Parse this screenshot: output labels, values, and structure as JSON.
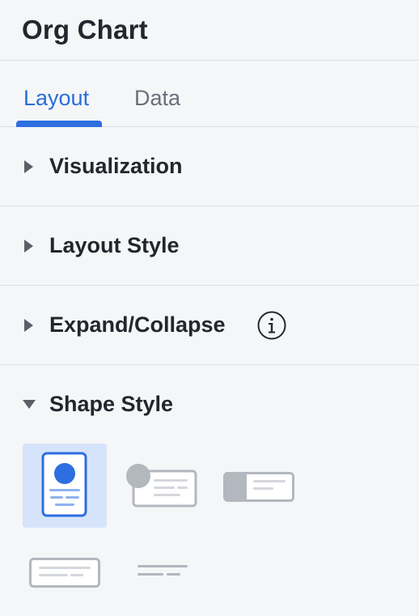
{
  "panel": {
    "title": "Org Chart"
  },
  "tabs": [
    {
      "label": "Layout",
      "active": true
    },
    {
      "label": "Data",
      "active": false
    }
  ],
  "sections": [
    {
      "label": "Visualization",
      "expanded": false
    },
    {
      "label": "Layout Style",
      "expanded": false
    },
    {
      "label": "Expand/Collapse",
      "expanded": false,
      "info_icon": "info-icon"
    },
    {
      "label": "Shape Style",
      "expanded": true
    }
  ],
  "shape_style": {
    "options": [
      {
        "name": "card-vertical-photo",
        "selected": true
      },
      {
        "name": "card-horizontal-photo",
        "selected": false
      },
      {
        "name": "card-side-block",
        "selected": false
      },
      {
        "name": "card-text-only",
        "selected": false
      },
      {
        "name": "lines-only",
        "selected": false
      }
    ]
  },
  "colors": {
    "accent": "#2d6ee0",
    "selected_bg": "#d6e4fb",
    "text": "#23262d",
    "muted": "#6a6f79",
    "border": "#dcdfe4",
    "shape_grey": "#b3b7be"
  }
}
